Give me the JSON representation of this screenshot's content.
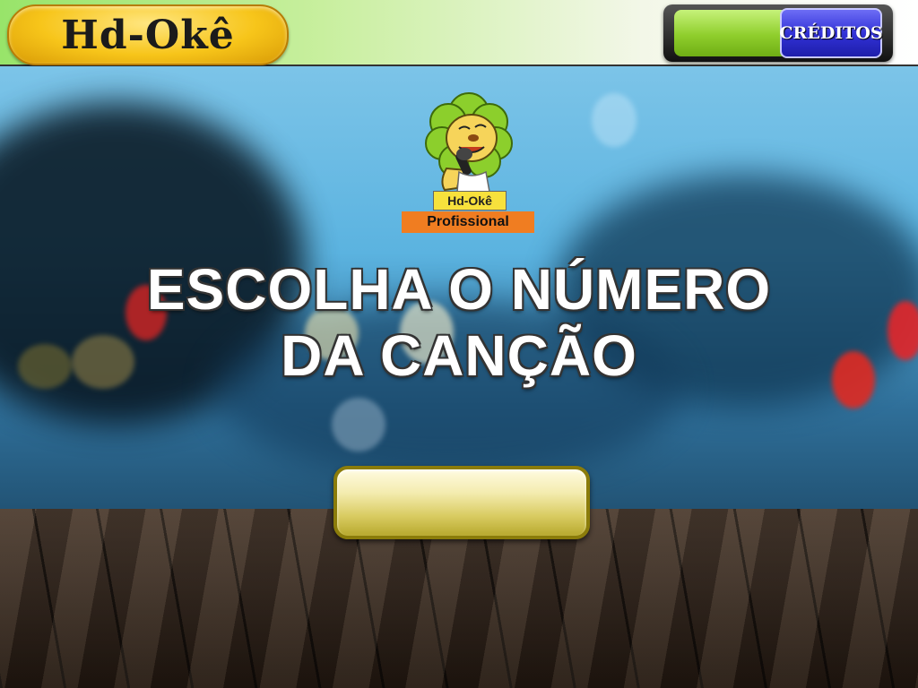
{
  "header": {
    "brand": "Hd-Okê",
    "credits_label": "CRÉDITOS"
  },
  "mascot": {
    "name": "Hd-Okê",
    "edition": "Profissional"
  },
  "main": {
    "title_line1": "ESCOLHA O NÚMERO",
    "title_line2": "DA CANÇÃO",
    "song_number_value": ""
  },
  "colors": {
    "brand_yellow": "#f7c51a",
    "credits_blue": "#3232d8",
    "credits_green": "#8fce2c",
    "button_gold": "#d9cc62",
    "edition_orange": "#f07d21"
  },
  "icons": [
    "lion-mascot-icon"
  ]
}
